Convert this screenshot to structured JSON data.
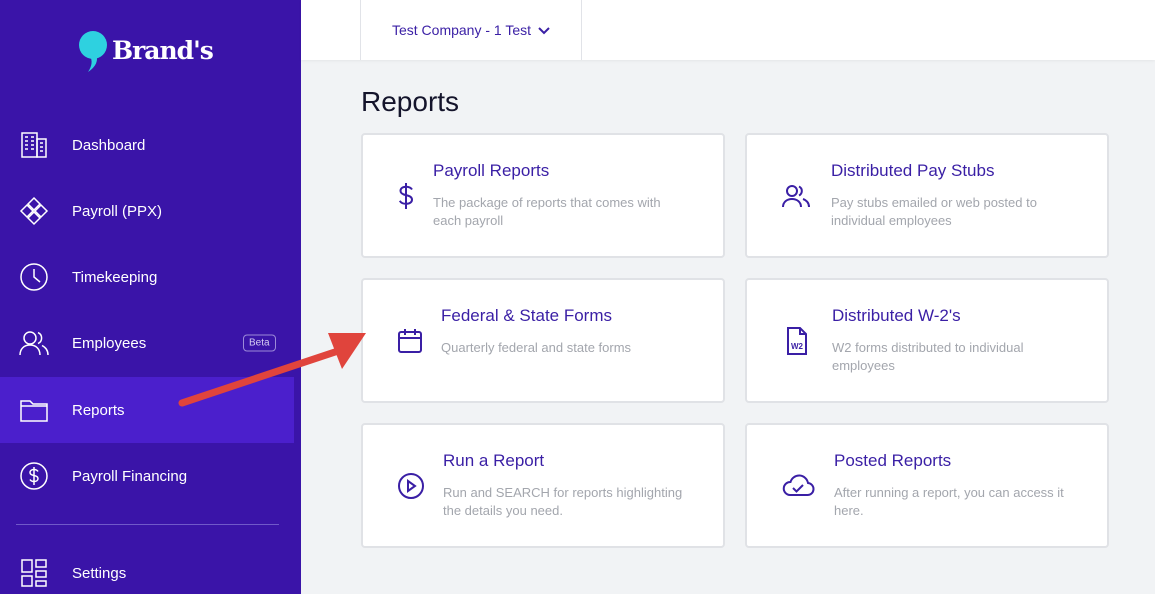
{
  "brand": {
    "name": "Brand's"
  },
  "sidebar": {
    "items": [
      {
        "label": "Dashboard",
        "icon": "building-icon"
      },
      {
        "label": "Payroll (PPX)",
        "icon": "diamond-grid-icon"
      },
      {
        "label": "Timekeeping",
        "icon": "clock-icon"
      },
      {
        "label": "Employees",
        "icon": "users-icon",
        "badge": "Beta"
      },
      {
        "label": "Reports",
        "icon": "folder-icon",
        "active": true
      },
      {
        "label": "Payroll Financing",
        "icon": "dollar-circle-icon"
      },
      {
        "label": "Settings",
        "icon": "grid-icon"
      }
    ]
  },
  "topbar": {
    "company": "Test Company - 1 Test"
  },
  "page": {
    "title": "Reports"
  },
  "cards": [
    {
      "title": "Payroll Reports",
      "desc": "The package of reports that comes with each payroll",
      "icon": "dollar-icon"
    },
    {
      "title": "Distributed Pay Stubs",
      "desc": "Pay stubs emailed or web posted to individual employees",
      "icon": "users-icon"
    },
    {
      "title": "Federal & State Forms",
      "desc": "Quarterly federal and state forms",
      "icon": "calendar-icon"
    },
    {
      "title": "Distributed W-2's",
      "desc": "W2 forms distributed to individual employees",
      "icon": "w2-document-icon"
    },
    {
      "title": "Run a Report",
      "desc": "Run and SEARCH for reports highlighting the details you need.",
      "icon": "play-circle-icon"
    },
    {
      "title": "Posted Reports",
      "desc": "After running a report, you can access it here.",
      "icon": "cloud-check-icon"
    }
  ],
  "colors": {
    "sidebar": "#3a14a8",
    "active": "#4b1fcc",
    "accent": "#3a1fa5",
    "annotation_arrow": "#e0443c"
  }
}
